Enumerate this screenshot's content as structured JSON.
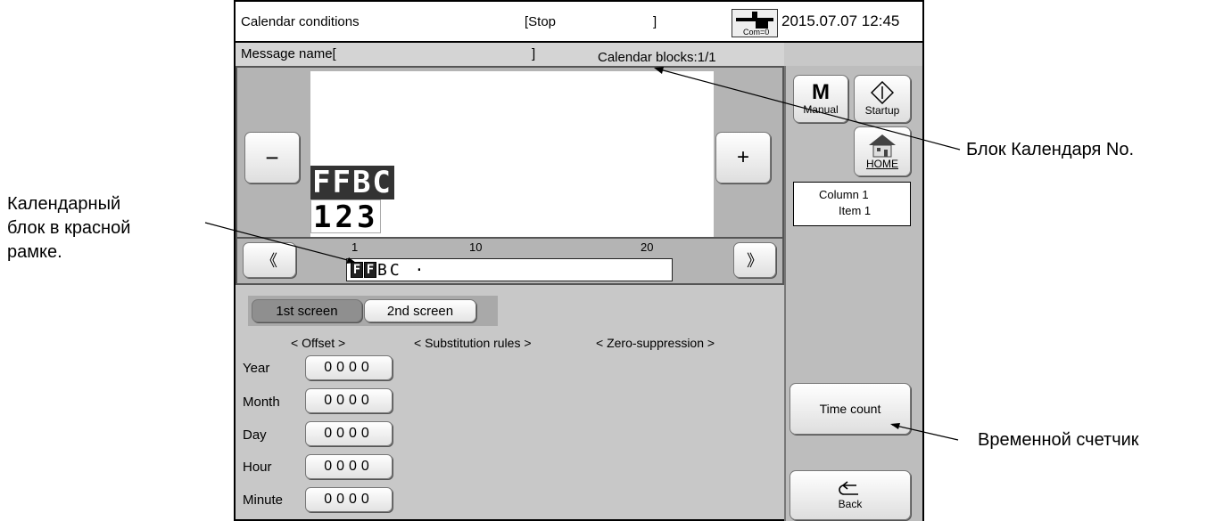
{
  "header": {
    "title": "Calendar conditions",
    "status": "[Stop",
    "status_close": "]",
    "com_label": "Com=0",
    "datetime": "2015.07.07 12:45"
  },
  "message_bar": {
    "name_label": "Message name[",
    "name_close": "]",
    "blocks": "Calendar blocks:1/1"
  },
  "preview": {
    "minus": "−",
    "plus": "+",
    "line1": "FFBC",
    "line2": "123"
  },
  "ruler": {
    "left_arrow": "《",
    "right_arrow": "》",
    "ticks": [
      "1",
      "10",
      "20"
    ],
    "highlighted_chars": [
      "F",
      "F"
    ],
    "rest_text": "BC ·"
  },
  "tabs": {
    "first": "1st screen",
    "second": "2nd screen"
  },
  "columns": {
    "offset": "< Offset >",
    "substitution": "< Substitution rules >",
    "zero": "< Zero-suppression >"
  },
  "rows": [
    {
      "label": "Year",
      "value": "0000"
    },
    {
      "label": "Month",
      "value": "0000"
    },
    {
      "label": "Day",
      "value": "0000"
    },
    {
      "label": "Hour",
      "value": "0000"
    },
    {
      "label": "Minute",
      "value": "0000"
    }
  ],
  "sidebar": {
    "manual_glyph": "M",
    "manual_label": "Manual",
    "startup_label": "Startup",
    "home_label": "HOME",
    "column_info": "Column 1",
    "item_info": "Item 1",
    "time_count": "Time count",
    "back_label": "Back"
  },
  "annotations": {
    "calendar_block_no": "Блок Календаря No.",
    "red_frame_line1": "Календарный",
    "red_frame_line2": "блок в красной",
    "red_frame_line3": "рамке.",
    "time_counter": "Временной счетчик"
  }
}
